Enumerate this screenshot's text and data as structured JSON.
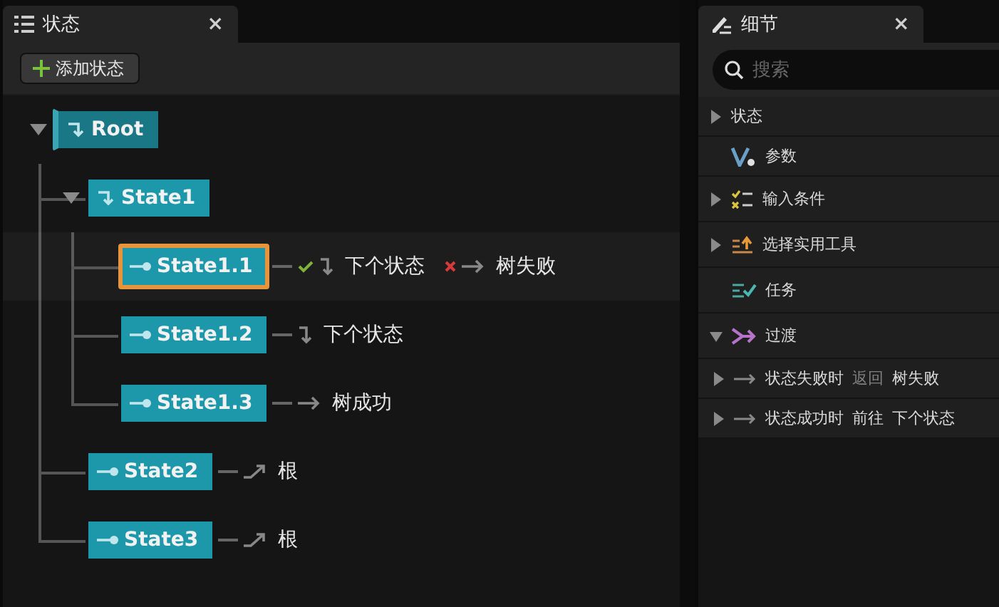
{
  "states_panel": {
    "tab": {
      "title": "状态",
      "close": "×"
    },
    "add_button": "添加状态",
    "tree": [
      {
        "name": "Root",
        "kind": "root",
        "selected": false,
        "expanded": true,
        "children": [
          {
            "name": "State1",
            "kind": "group",
            "selected": false,
            "expanded": true,
            "children": [
              {
                "name": "State1.1",
                "kind": "leaf",
                "selected": true,
                "transitions": [
                  {
                    "kind": "success-next",
                    "target": "下个状态"
                  },
                  {
                    "kind": "failure-goto",
                    "target": "树失败"
                  }
                ]
              },
              {
                "name": "State1.2",
                "kind": "leaf",
                "selected": false,
                "transitions": [
                  {
                    "kind": "next",
                    "target": "下个状态"
                  }
                ]
              },
              {
                "name": "State1.3",
                "kind": "leaf",
                "selected": false,
                "transitions": [
                  {
                    "kind": "goto",
                    "target": "树成功"
                  }
                ]
              }
            ]
          },
          {
            "name": "State2",
            "kind": "leaf",
            "selected": false,
            "transitions": [
              {
                "kind": "root",
                "target": "根"
              }
            ]
          },
          {
            "name": "State3",
            "kind": "leaf",
            "selected": false,
            "transitions": [
              {
                "kind": "root",
                "target": "根"
              }
            ]
          }
        ]
      }
    ]
  },
  "details_panel": {
    "tab": {
      "title": "细节",
      "close": "×"
    },
    "search": {
      "placeholder": "搜索"
    },
    "sections": [
      {
        "label": "状态",
        "kind": "plain",
        "expanded": false
      },
      {
        "label": "参数",
        "kind": "parameter"
      },
      {
        "label": "输入条件",
        "kind": "conditions",
        "expanded": false
      },
      {
        "label": "选择实用工具",
        "kind": "utility",
        "expanded": false
      },
      {
        "label": "任务",
        "kind": "task"
      },
      {
        "label": "过渡",
        "kind": "transition",
        "expanded": true,
        "children": [
          {
            "expanded": false,
            "parts": [
              {
                "text": "状态失败时",
                "dim": false
              },
              {
                "text": "返回",
                "dim": true
              },
              {
                "text": "树失败",
                "dim": false
              }
            ]
          },
          {
            "expanded": false,
            "parts": [
              {
                "text": "状态成功时",
                "dim": false
              },
              {
                "text": "前往",
                "dim": false
              },
              {
                "text": "下个状态",
                "dim": false
              }
            ]
          }
        ]
      }
    ]
  }
}
